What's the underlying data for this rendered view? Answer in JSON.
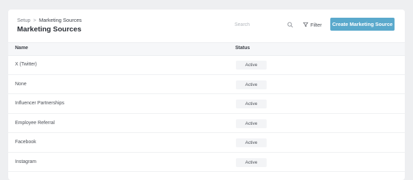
{
  "breadcrumb": {
    "parent": "Setup",
    "separator": ">",
    "current": "Marketing Sources"
  },
  "page_title": "Marketing Sources",
  "search": {
    "placeholder": "Search",
    "icon": "search-icon"
  },
  "filter": {
    "label": "Filter",
    "icon": "funnel-icon"
  },
  "create_button": {
    "label": "Create Marketing Source",
    "color": "#5aa9cc"
  },
  "table": {
    "columns": {
      "name": "Name",
      "status": "Status"
    },
    "rows": [
      {
        "name": "X (Twitter)",
        "status": "Active"
      },
      {
        "name": "None",
        "status": "Active"
      },
      {
        "name": "Influencer Partnerships",
        "status": "Active"
      },
      {
        "name": "Employee Referral",
        "status": "Active"
      },
      {
        "name": "Facebook",
        "status": "Active"
      },
      {
        "name": "Instagram",
        "status": "Active"
      }
    ]
  }
}
